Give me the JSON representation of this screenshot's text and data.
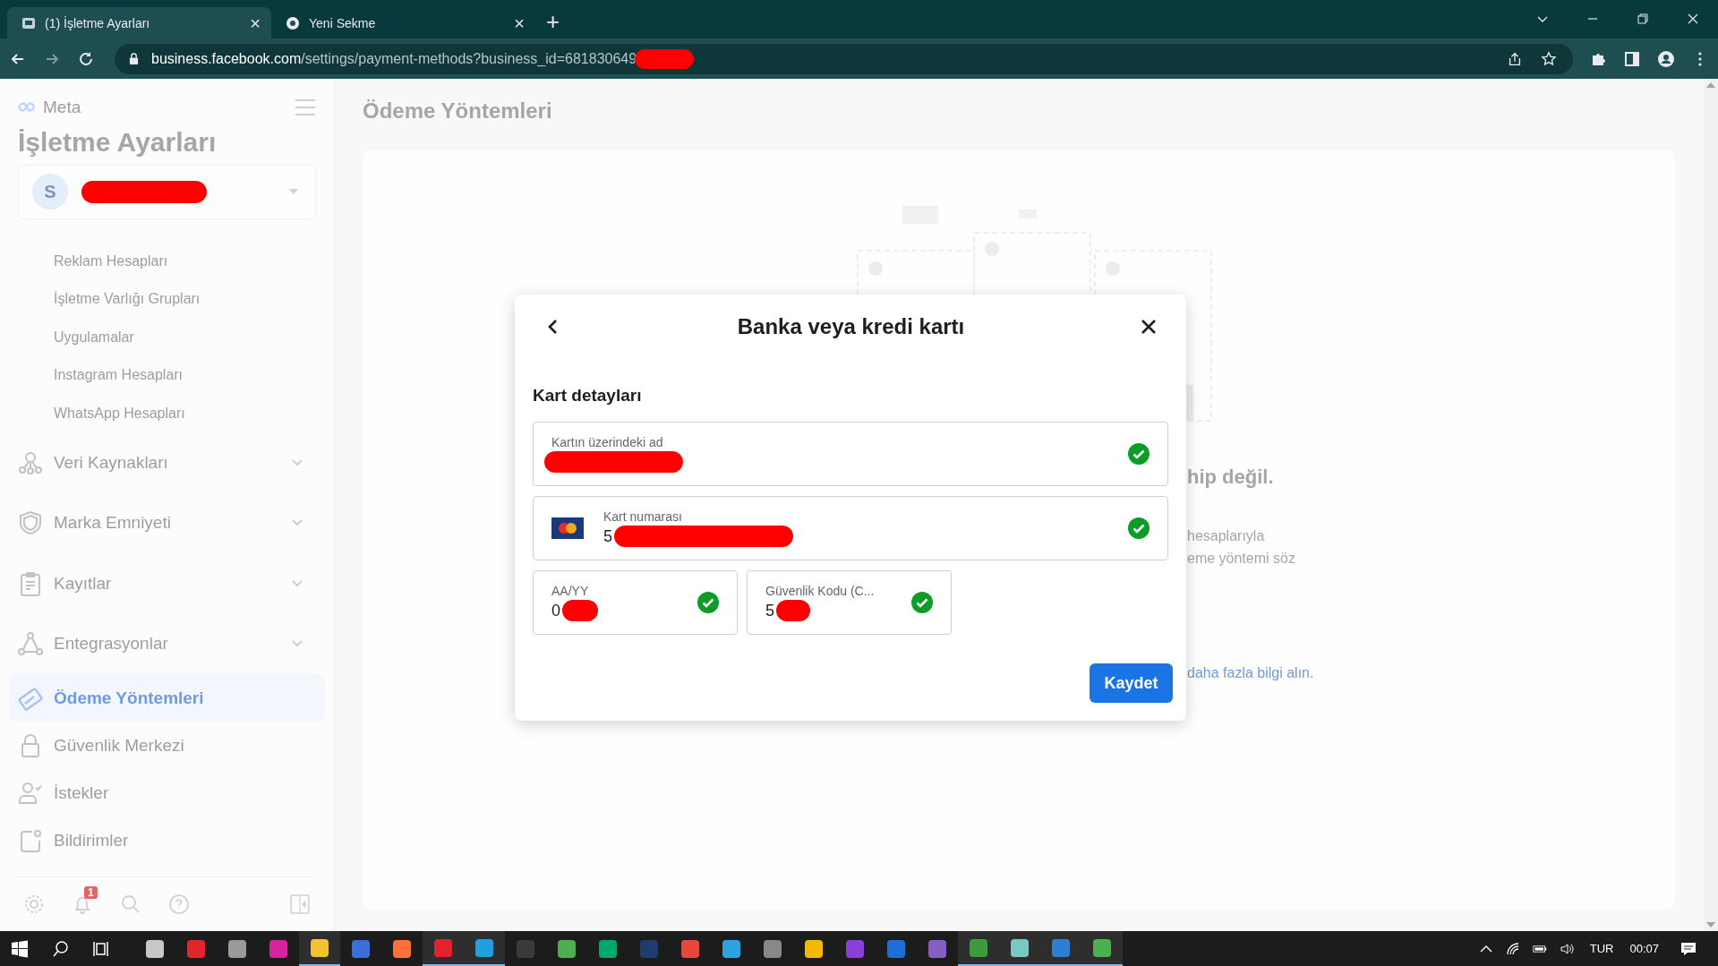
{
  "browser": {
    "tabs": [
      {
        "title": "(1) İşletme Ayarları",
        "selected": true,
        "close": "×"
      },
      {
        "title": "Yeni Sekme",
        "selected": false,
        "close": "×"
      }
    ],
    "new_tab": "+",
    "address": {
      "host": "business.facebook.com",
      "path": "/settings/payment-methods?business_id=681830649",
      "redacted": true
    }
  },
  "sidebar": {
    "logo": "Meta",
    "title": "İşletme Ayarları",
    "account": {
      "initial": "S",
      "redacted": true
    },
    "items": [
      {
        "kind": "sub",
        "label": "Reklam Hesapları",
        "selected": false
      },
      {
        "kind": "sub",
        "label": "İşletme Varlığı Grupları",
        "selected": false
      },
      {
        "kind": "sub",
        "label": "Uygulamalar",
        "selected": false
      },
      {
        "kind": "sub",
        "label": "Instagram Hesapları",
        "selected": false
      },
      {
        "kind": "sub",
        "label": "WhatsApp Hesapları",
        "selected": false
      },
      {
        "kind": "nodes",
        "label": "Veri Kaynakları",
        "selected": false,
        "expanded": false
      },
      {
        "kind": "shield",
        "label": "Marka Emniyeti",
        "selected": false,
        "expanded": false
      },
      {
        "kind": "clipboard",
        "label": "Kayıtlar",
        "selected": false,
        "expanded": false
      },
      {
        "kind": "triangle",
        "label": "Entegrasyonlar",
        "selected": false,
        "expanded": false
      },
      {
        "kind": "card",
        "label": "Ödeme Yöntemleri",
        "selected": true
      },
      {
        "kind": "lock",
        "label": "Güvenlik Merkezi",
        "selected": false
      },
      {
        "kind": "person",
        "label": "İstekler",
        "selected": false
      },
      {
        "kind": "notify",
        "label": "Bildirimler",
        "selected": false
      }
    ],
    "footer": {
      "notification_count": "1"
    }
  },
  "page": {
    "title": "Ödeme Yöntemleri",
    "empty_title": "hip değil.",
    "empty_lines": [
      "hesaplarıyla",
      "eme yöntemi söz"
    ],
    "link": "daha fazla bilgi alın."
  },
  "dialog": {
    "title": "Banka veya kredi kartı",
    "section": "Kart detayları",
    "fields": [
      {
        "kind": "name",
        "label": "Kartın üzerindeki ad",
        "valid": true,
        "redacted": true
      },
      {
        "kind": "card",
        "label": "Kart numarası",
        "value": "5",
        "valid": true,
        "redacted": true
      },
      {
        "kind": "expiry",
        "label": "AA/YY",
        "value": "0",
        "valid": true,
        "redacted": true
      },
      {
        "kind": "cvc",
        "label": "Güvenlik Kodu (C...",
        "value": "5",
        "valid": true,
        "redacted": true
      }
    ],
    "save": "Kaydet"
  },
  "taskbar": {
    "apps": [
      {
        "color": "#c8c8c8",
        "active": false
      },
      {
        "color": "#e0262b",
        "active": false
      },
      {
        "color": "#9a9a9a",
        "active": false
      },
      {
        "color": "#d6249f",
        "active": false
      },
      {
        "color": "#f2c230",
        "active": true
      },
      {
        "color": "#3a6ed8",
        "active": false
      },
      {
        "color": "#ff7139",
        "active": false
      },
      {
        "color": "#e0232e",
        "active": true
      },
      {
        "color": "#1fa0e0",
        "active": true
      },
      {
        "color": "#3a3a3a",
        "active": false
      },
      {
        "color": "#4caf50",
        "active": false
      },
      {
        "color": "#00a86b",
        "active": false
      },
      {
        "color": "#1c3d6e",
        "active": false
      },
      {
        "color": "#e8453c",
        "active": false
      },
      {
        "color": "#2aa3e0",
        "active": false
      },
      {
        "color": "#888888",
        "active": false
      },
      {
        "color": "#f5b800",
        "active": false
      },
      {
        "color": "#8b3fd9",
        "active": false
      },
      {
        "color": "#1e6fd9",
        "active": false
      },
      {
        "color": "#865fc5",
        "active": false
      },
      {
        "color": "#3c9b3c",
        "active": true
      },
      {
        "color": "#7bc7c4",
        "active": true
      },
      {
        "color": "#2d7fd1",
        "active": true
      },
      {
        "color": "#4caf50",
        "active": true
      }
    ],
    "language": "TUR",
    "time": "00:07"
  }
}
